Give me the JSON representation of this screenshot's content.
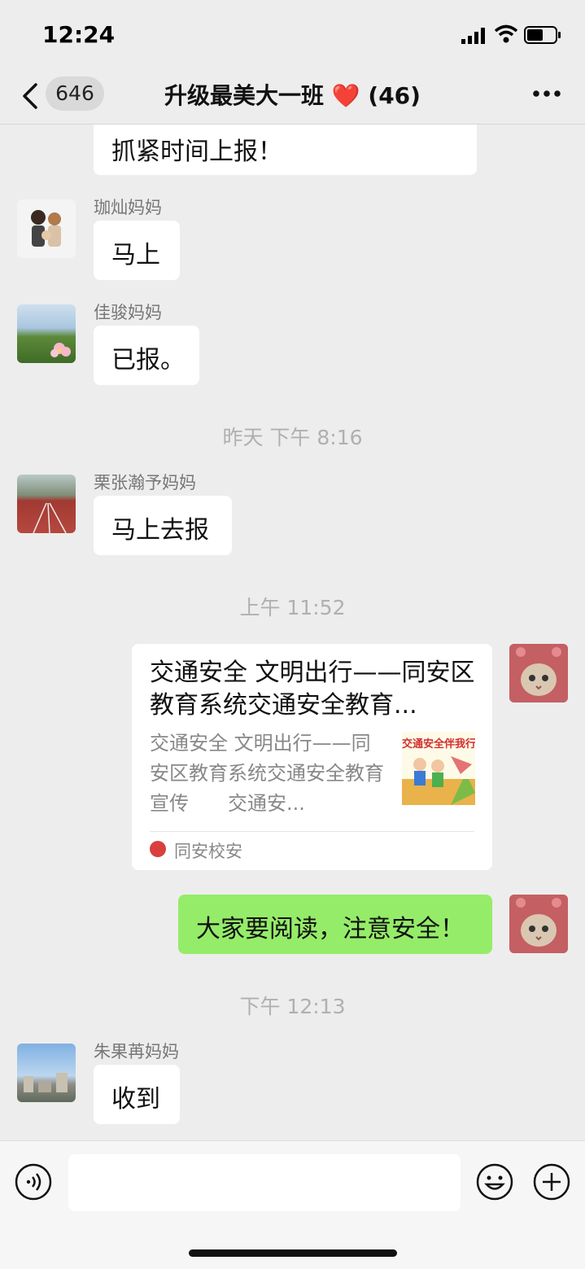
{
  "status_bar": {
    "time": "12:24"
  },
  "header": {
    "unread_count": "646",
    "title": "升级最美大一班 ❤️ (46)"
  },
  "messages": [
    {
      "type": "partial",
      "text": "抓紧时间上报！"
    },
    {
      "type": "incoming",
      "sender": "珈灿妈妈",
      "text": "马上"
    },
    {
      "type": "incoming",
      "sender": "佳骏妈妈",
      "text": "已报。"
    },
    {
      "type": "timestamp",
      "text": "昨天 下午 8:16"
    },
    {
      "type": "incoming",
      "sender": "栗张瀚予妈妈",
      "text": "马上去报"
    },
    {
      "type": "timestamp",
      "text": "上午 11:52"
    },
    {
      "type": "outgoing_card",
      "title": "交通安全 文明出行——同安区教育系统交通安全教育...",
      "description": "交通安全 文明出行——同安区教育系统交通安全教育宣传　　交通安...",
      "thumbnail_caption": "交通安全伴我行",
      "source": "同安校安"
    },
    {
      "type": "outgoing",
      "text": "大家要阅读，注意安全！"
    },
    {
      "type": "timestamp",
      "text": "下午 12:13"
    },
    {
      "type": "incoming",
      "sender": "朱果苒妈妈",
      "text": "收到"
    }
  ],
  "colors": {
    "background": "#ededed",
    "outgoing_bubble": "#95ec69",
    "incoming_bubble": "#ffffff"
  },
  "icons": [
    "back-icon",
    "more-icon",
    "voice-icon",
    "emoji-icon",
    "plus-icon"
  ]
}
